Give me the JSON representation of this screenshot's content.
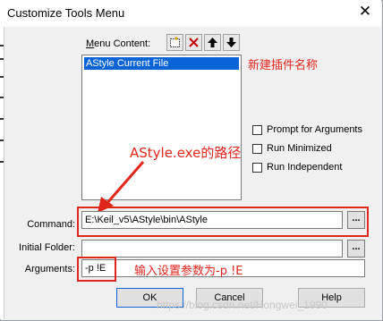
{
  "window": {
    "title": "Customize Tools Menu",
    "close_glyph": "✕"
  },
  "menu": {
    "label_prefix": "M",
    "label_rest": "enu Content:",
    "toolbar": [
      "new-icon",
      "delete-icon",
      "move-up-icon",
      "move-down-icon"
    ],
    "items": [
      "AStyle Current File"
    ]
  },
  "annotations": {
    "new_plugin_name": "新建插件名称",
    "astyle_path": "AStyle.exe的路径",
    "arguments_hint": "输入设置参数为-p !E"
  },
  "options": [
    {
      "label": "Prompt for  Arguments",
      "checked": false
    },
    {
      "label": "Run Minimized",
      "checked": false
    },
    {
      "label": "Run Independent",
      "checked": false
    }
  ],
  "fields": {
    "command_label": "Command:",
    "command_value": "E:\\Keil_v5\\AStyle\\bin\\AStyle",
    "initial_folder_label": "Initial Folder:",
    "initial_folder_value": "",
    "arguments_label": "Arguments:",
    "arguments_value": "-p !E",
    "browse_label": "..."
  },
  "buttons": {
    "ok": "OK",
    "cancel": "Cancel",
    "help": "Help"
  },
  "watermark": "https://blog.csdn.net/Hongwei_1990",
  "colors": {
    "annotation": "#e1261c",
    "selection": "#0a64d6"
  }
}
